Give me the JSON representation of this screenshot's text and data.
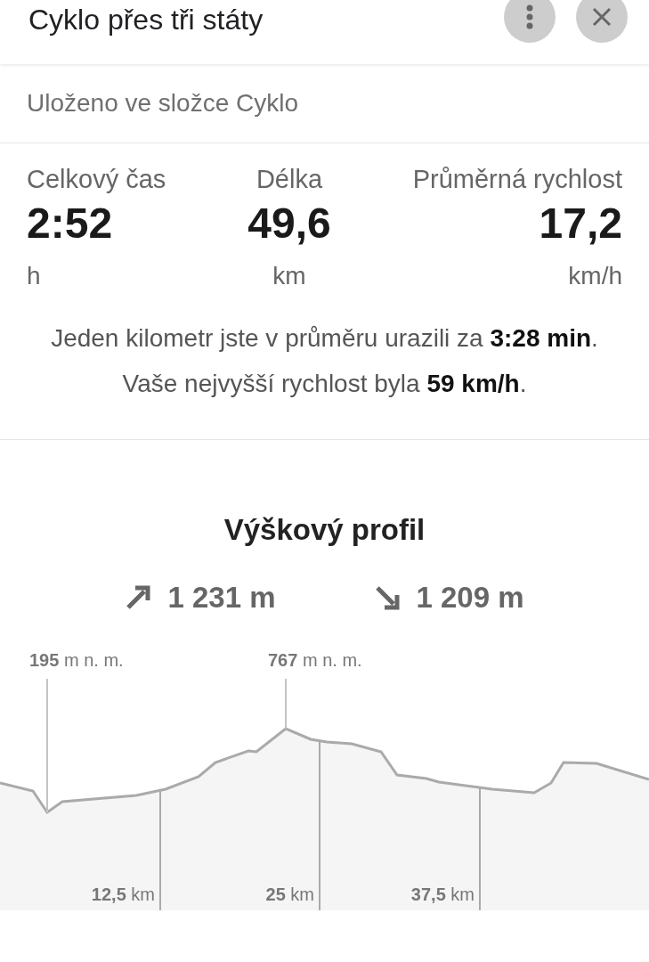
{
  "header": {
    "title": "Cyklo přes tři státy",
    "buttons": [
      {
        "kind": "more"
      },
      {
        "kind": "close"
      }
    ]
  },
  "folder": "Uloženo ve složce Cyklo",
  "stats": [
    {
      "label": "Celkový čas",
      "value": "2:52",
      "unit": "h"
    },
    {
      "label": "Délka",
      "value": "49,6",
      "unit": "km"
    },
    {
      "label": "Průměrná rychlost",
      "value": "17,2",
      "unit": "km/h"
    }
  ],
  "summary": [
    "Jeden kilometr jste v průměru urazili za **3:28 min**.",
    "Vaše nejvyšší rychlost byla **59 km/h**."
  ],
  "elevation": {
    "title": "Výškový profil",
    "totals": [
      {
        "kind": "ascent",
        "value": "1 231 m"
      },
      {
        "kind": "descent",
        "value": "1 209 m"
      }
    ],
    "extremes": [
      {
        "kind": "min",
        "label": "**195** m n. m."
      },
      {
        "kind": "max",
        "label": "**767** m n. m."
      }
    ],
    "distance_marks": [
      "**12,5** km",
      "**25** km",
      "**37,5** km"
    ]
  }
}
